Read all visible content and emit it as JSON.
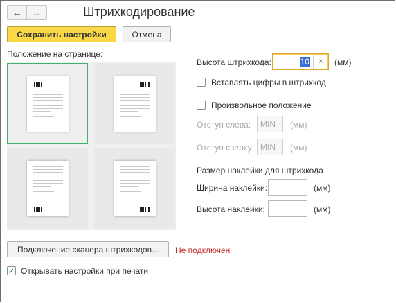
{
  "window": {
    "title": "Штрихкодирование",
    "nav": {
      "back_glyph": "←",
      "forward_glyph": "→",
      "back_icon": "arrow-left-icon",
      "forward_icon": "arrow-right-icon"
    }
  },
  "toolbar": {
    "save_label": "Сохранить настройки",
    "cancel_label": "Отмена"
  },
  "position": {
    "label": "Положение на странице:",
    "options": [
      {
        "selected": true,
        "barcode_position": "top-left"
      },
      {
        "selected": false,
        "barcode_position": "top-right"
      },
      {
        "selected": false,
        "barcode_position": "bottom-left"
      },
      {
        "selected": false,
        "barcode_position": "bottom-right"
      }
    ]
  },
  "barcode": {
    "height_label": "Высота штрихкода:",
    "height_value": "10",
    "clear_glyph": "×",
    "unit": "(мм)",
    "insert_digits_label": "Вставлять цифры в штрихкод",
    "insert_digits_checked": false,
    "custom_position_label": "Произвольное положение",
    "custom_position_checked": false,
    "offset_left_label": "Отступ слева:",
    "offset_left_placeholder": "MIN",
    "offset_top_label": "Отступ сверху:",
    "offset_top_placeholder": "MIN"
  },
  "sticker": {
    "heading": "Размер наклейки для штрихкода",
    "width_label": "Ширина наклейки:",
    "width_value": "",
    "height_label": "Высота наклейки:",
    "height_value": "",
    "unit": "(мм)"
  },
  "scanner": {
    "button_label": "Подключение сканера штрихкодов...",
    "status": "Не подключен",
    "status_color": "#c22a2a"
  },
  "print": {
    "open_on_print_label": "Открывать настройки при печати",
    "open_on_print_checked": true,
    "check_glyph": "✓"
  },
  "colors": {
    "accent": "#fcd849",
    "selected_border": "#3fb36a",
    "focus_border": "#e1a92b"
  }
}
